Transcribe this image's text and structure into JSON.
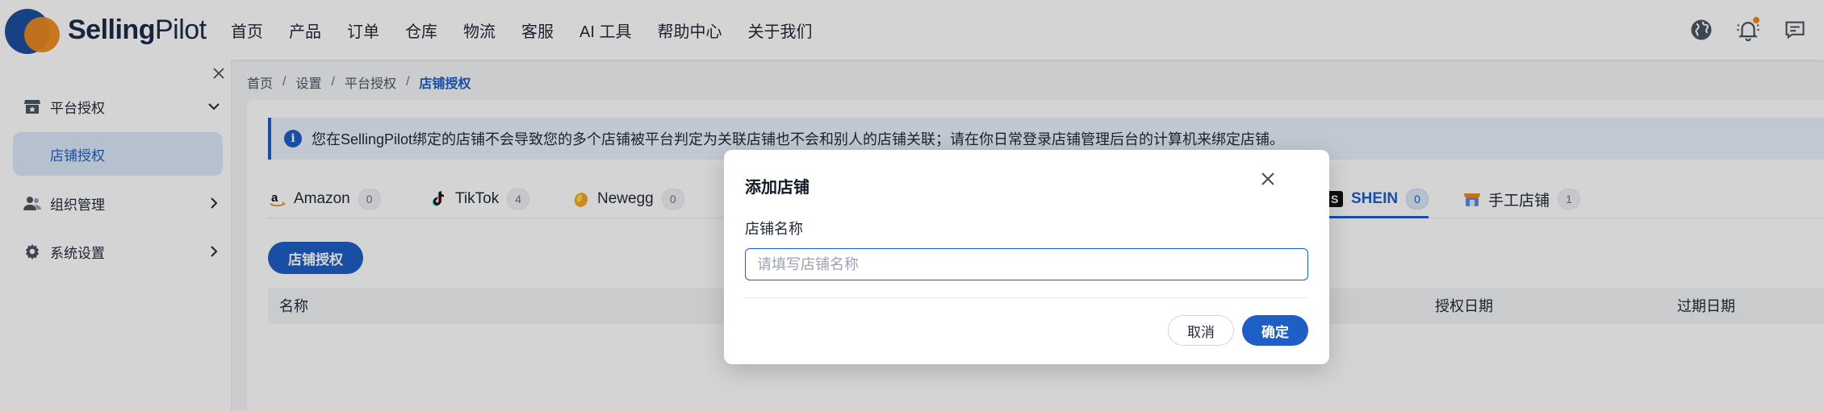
{
  "brand": {
    "name_bold": "Selling",
    "name_regular": "Pilot",
    "colors": {
      "primary": "#1d4f9e",
      "accent": "#f08a1c"
    }
  },
  "nav": {
    "items": [
      {
        "label": "首页"
      },
      {
        "label": "产品"
      },
      {
        "label": "订单"
      },
      {
        "label": "仓库"
      },
      {
        "label": "物流"
      },
      {
        "label": "客服"
      },
      {
        "label": "AI 工具"
      },
      {
        "label": "帮助中心"
      },
      {
        "label": "关于我们"
      }
    ],
    "icons": [
      "globe-icon",
      "bell-icon",
      "message-icon"
    ]
  },
  "sidebar": {
    "groups": [
      {
        "label": "平台授权",
        "icon": "store-icon",
        "expanded": true
      },
      {
        "label": "组织管理",
        "icon": "users-icon",
        "expanded": false
      },
      {
        "label": "系统设置",
        "icon": "gear-icon",
        "expanded": false
      }
    ],
    "active_sub": "店铺授权"
  },
  "breadcrumb": {
    "items": [
      "首页",
      "设置",
      "平台授权"
    ],
    "current": "店铺授权"
  },
  "notice": {
    "text": "您在SellingPilot绑定的店铺不会导致您的多个店铺被平台判定为关联店铺也不会和别人的店铺关联；请在你日常登录店铺管理后台的计算机来绑定店铺。"
  },
  "tabs": [
    {
      "label": "Amazon",
      "count": "0",
      "icon": "amazon-icon"
    },
    {
      "label": "TikTok",
      "count": "4",
      "icon": "tiktok-icon"
    },
    {
      "label": "Newegg",
      "count": "0",
      "icon": "newegg-icon"
    },
    {
      "label": "SHEIN",
      "count": "0",
      "icon": "shein-icon",
      "active": true
    },
    {
      "label": "手工店铺",
      "count": "1",
      "icon": "manual-store-icon"
    }
  ],
  "actions": {
    "authorize": "店铺授权"
  },
  "table": {
    "headers": [
      "名称",
      "授权日期",
      "过期日期"
    ]
  },
  "modal": {
    "title": "添加店铺",
    "field_label": "店铺名称",
    "input_value": "",
    "input_placeholder": "请填写店铺名称",
    "cancel": "取消",
    "confirm": "确定"
  }
}
